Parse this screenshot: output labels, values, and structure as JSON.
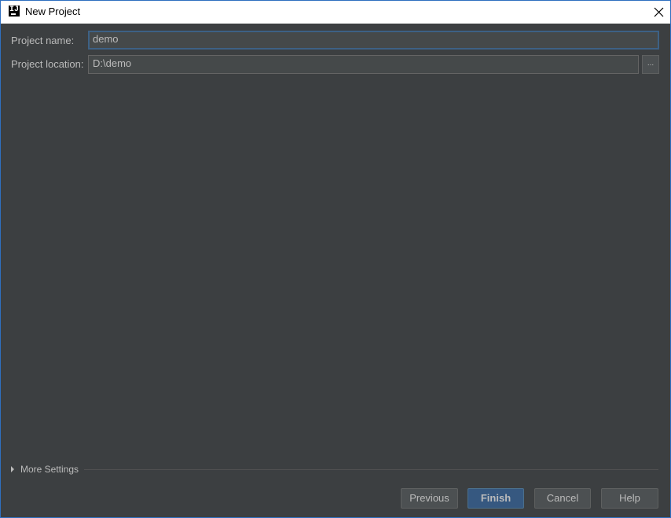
{
  "window": {
    "title": "New Project",
    "app_icon_text": "IJ"
  },
  "form": {
    "project_name_label": "Project name:",
    "project_name_value": "demo",
    "project_location_label": "Project location:",
    "project_location_value": "D:\\demo",
    "browse_label": "..."
  },
  "more_settings_label": "More Settings",
  "buttons": {
    "previous": "Previous",
    "finish": "Finish",
    "cancel": "Cancel",
    "help": "Help"
  }
}
